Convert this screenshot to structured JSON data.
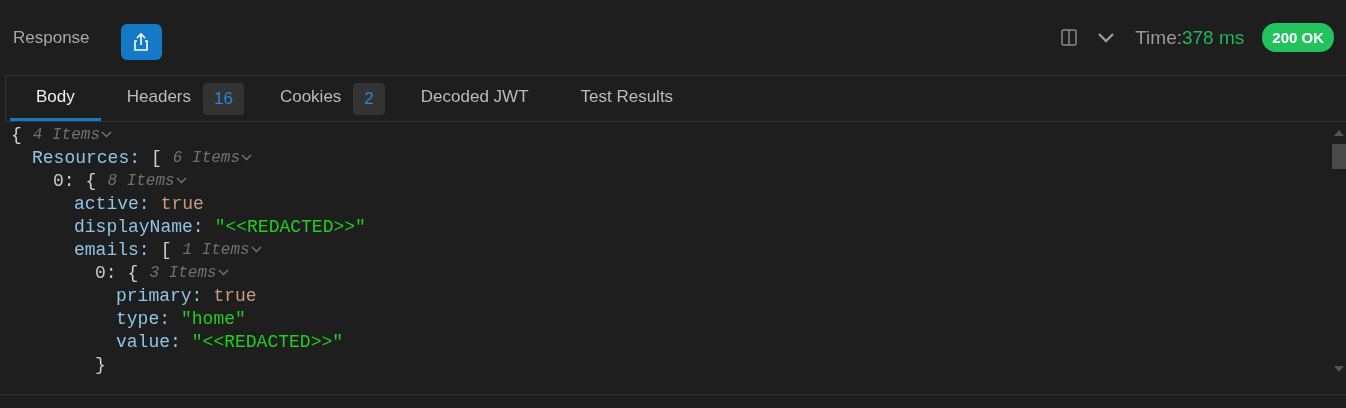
{
  "header": {
    "title": "Response",
    "time_label": "Time:",
    "time_value": "378 ms",
    "status": "200 OK"
  },
  "tabs": [
    {
      "label": "Body",
      "selected": true
    },
    {
      "label": "Headers",
      "badge": "16",
      "selected": false
    },
    {
      "label": "Cookies",
      "badge": "2",
      "selected": false
    },
    {
      "label": "Decoded JWT",
      "selected": false
    },
    {
      "label": "Test Results",
      "selected": false
    }
  ],
  "tree": {
    "bracket": "{",
    "count": "4 Items",
    "children": [
      {
        "key": "Resources:",
        "bracket": "[",
        "count": "6 Items",
        "children": [
          {
            "key": "0:",
            "bracket": "{",
            "count": "8 Items",
            "children": [
              {
                "key": "active:",
                "value": "true",
                "kind": "boolean"
              },
              {
                "key": "displayName:",
                "value": "\"<<REDACTED>>\"",
                "kind": "string"
              },
              {
                "key": "emails:",
                "bracket": "[",
                "count": "1 Items",
                "children": [
                  {
                    "key": "0:",
                    "bracket": "{",
                    "count": "3 Items",
                    "close": "}",
                    "children": [
                      {
                        "key": "primary:",
                        "value": "true",
                        "kind": "boolean"
                      },
                      {
                        "key": "type:",
                        "value": "\"home\"",
                        "kind": "string"
                      },
                      {
                        "key": "value:",
                        "value": "\"<<REDACTED>>\"",
                        "kind": "string"
                      }
                    ]
                  }
                ]
              }
            ]
          }
        ]
      }
    ]
  }
}
